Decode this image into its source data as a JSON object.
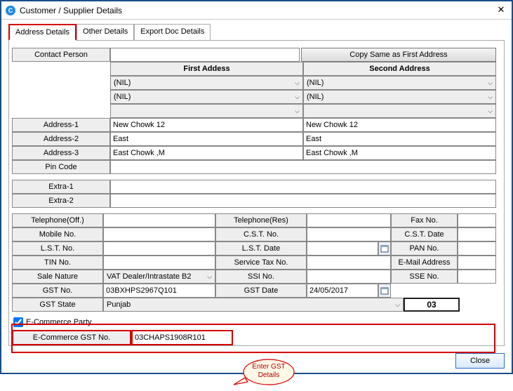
{
  "window": {
    "title": "Customer / Supplier Details"
  },
  "tabs": {
    "t1": "Address Details",
    "t2": "Other Details",
    "t3": "Export Doc Details"
  },
  "labels": {
    "contact_person": "Contact Person",
    "copy_same": "Copy Same as First Address",
    "first_address": "First Addess",
    "second_address": "Second Address",
    "address1": "Address-1",
    "address2": "Address-2",
    "address3": "Address-3",
    "pincode": "Pin Code",
    "extra1": "Extra-1",
    "extra2": "Extra-2",
    "tel_off": "Telephone(Off.)",
    "tel_res": "Telephone(Res)",
    "fax_no": "Fax No.",
    "mobile_no": "Mobile No.",
    "cst_no": "C.S.T. No.",
    "cst_date": "C.S.T. Date",
    "lst_no": "L.S.T. No.",
    "lst_date": "L.S.T. Date",
    "pan_no": "PAN No.",
    "tin_no": "TIN No.",
    "service_tax_no": "Service Tax No.",
    "email": "E-Mail Address",
    "sale_nature": "Sale Nature",
    "ssi_no": "SSI No.",
    "sse_no": "SSE No.",
    "gst_no": "GST No.",
    "gst_date": "GST Date",
    "gst_state": "GST State",
    "ecom_party": "E-Commerce Party",
    "ecom_gst_no": "E-Commerce GST No."
  },
  "values": {
    "contact_person": "",
    "nil1a": "(NIL)",
    "nil1b": "(NIL)",
    "nil2a": "(NIL)",
    "nil2b": "(NIL)",
    "addr1a": "New Chowk 12",
    "addr2a": "East",
    "addr3a": "East Chowk ,M",
    "addr1b": "New Chowk 12",
    "addr2b": "East",
    "addr3b": "East Chowk ,M",
    "pincode": "",
    "extra1": "",
    "extra2": "",
    "sale_nature": "VAT Dealer/Intrastate B2",
    "gst_no": "03BXHPS2967Q101",
    "gst_date": "24/05/2017",
    "gst_state": "Punjab",
    "state_code": "03",
    "ecom_checked": true,
    "ecom_gst_no": "03CHAPS1908R101"
  },
  "callout": {
    "line1": "Enter GST",
    "line2": "Details"
  },
  "footer": {
    "close": "Close"
  }
}
